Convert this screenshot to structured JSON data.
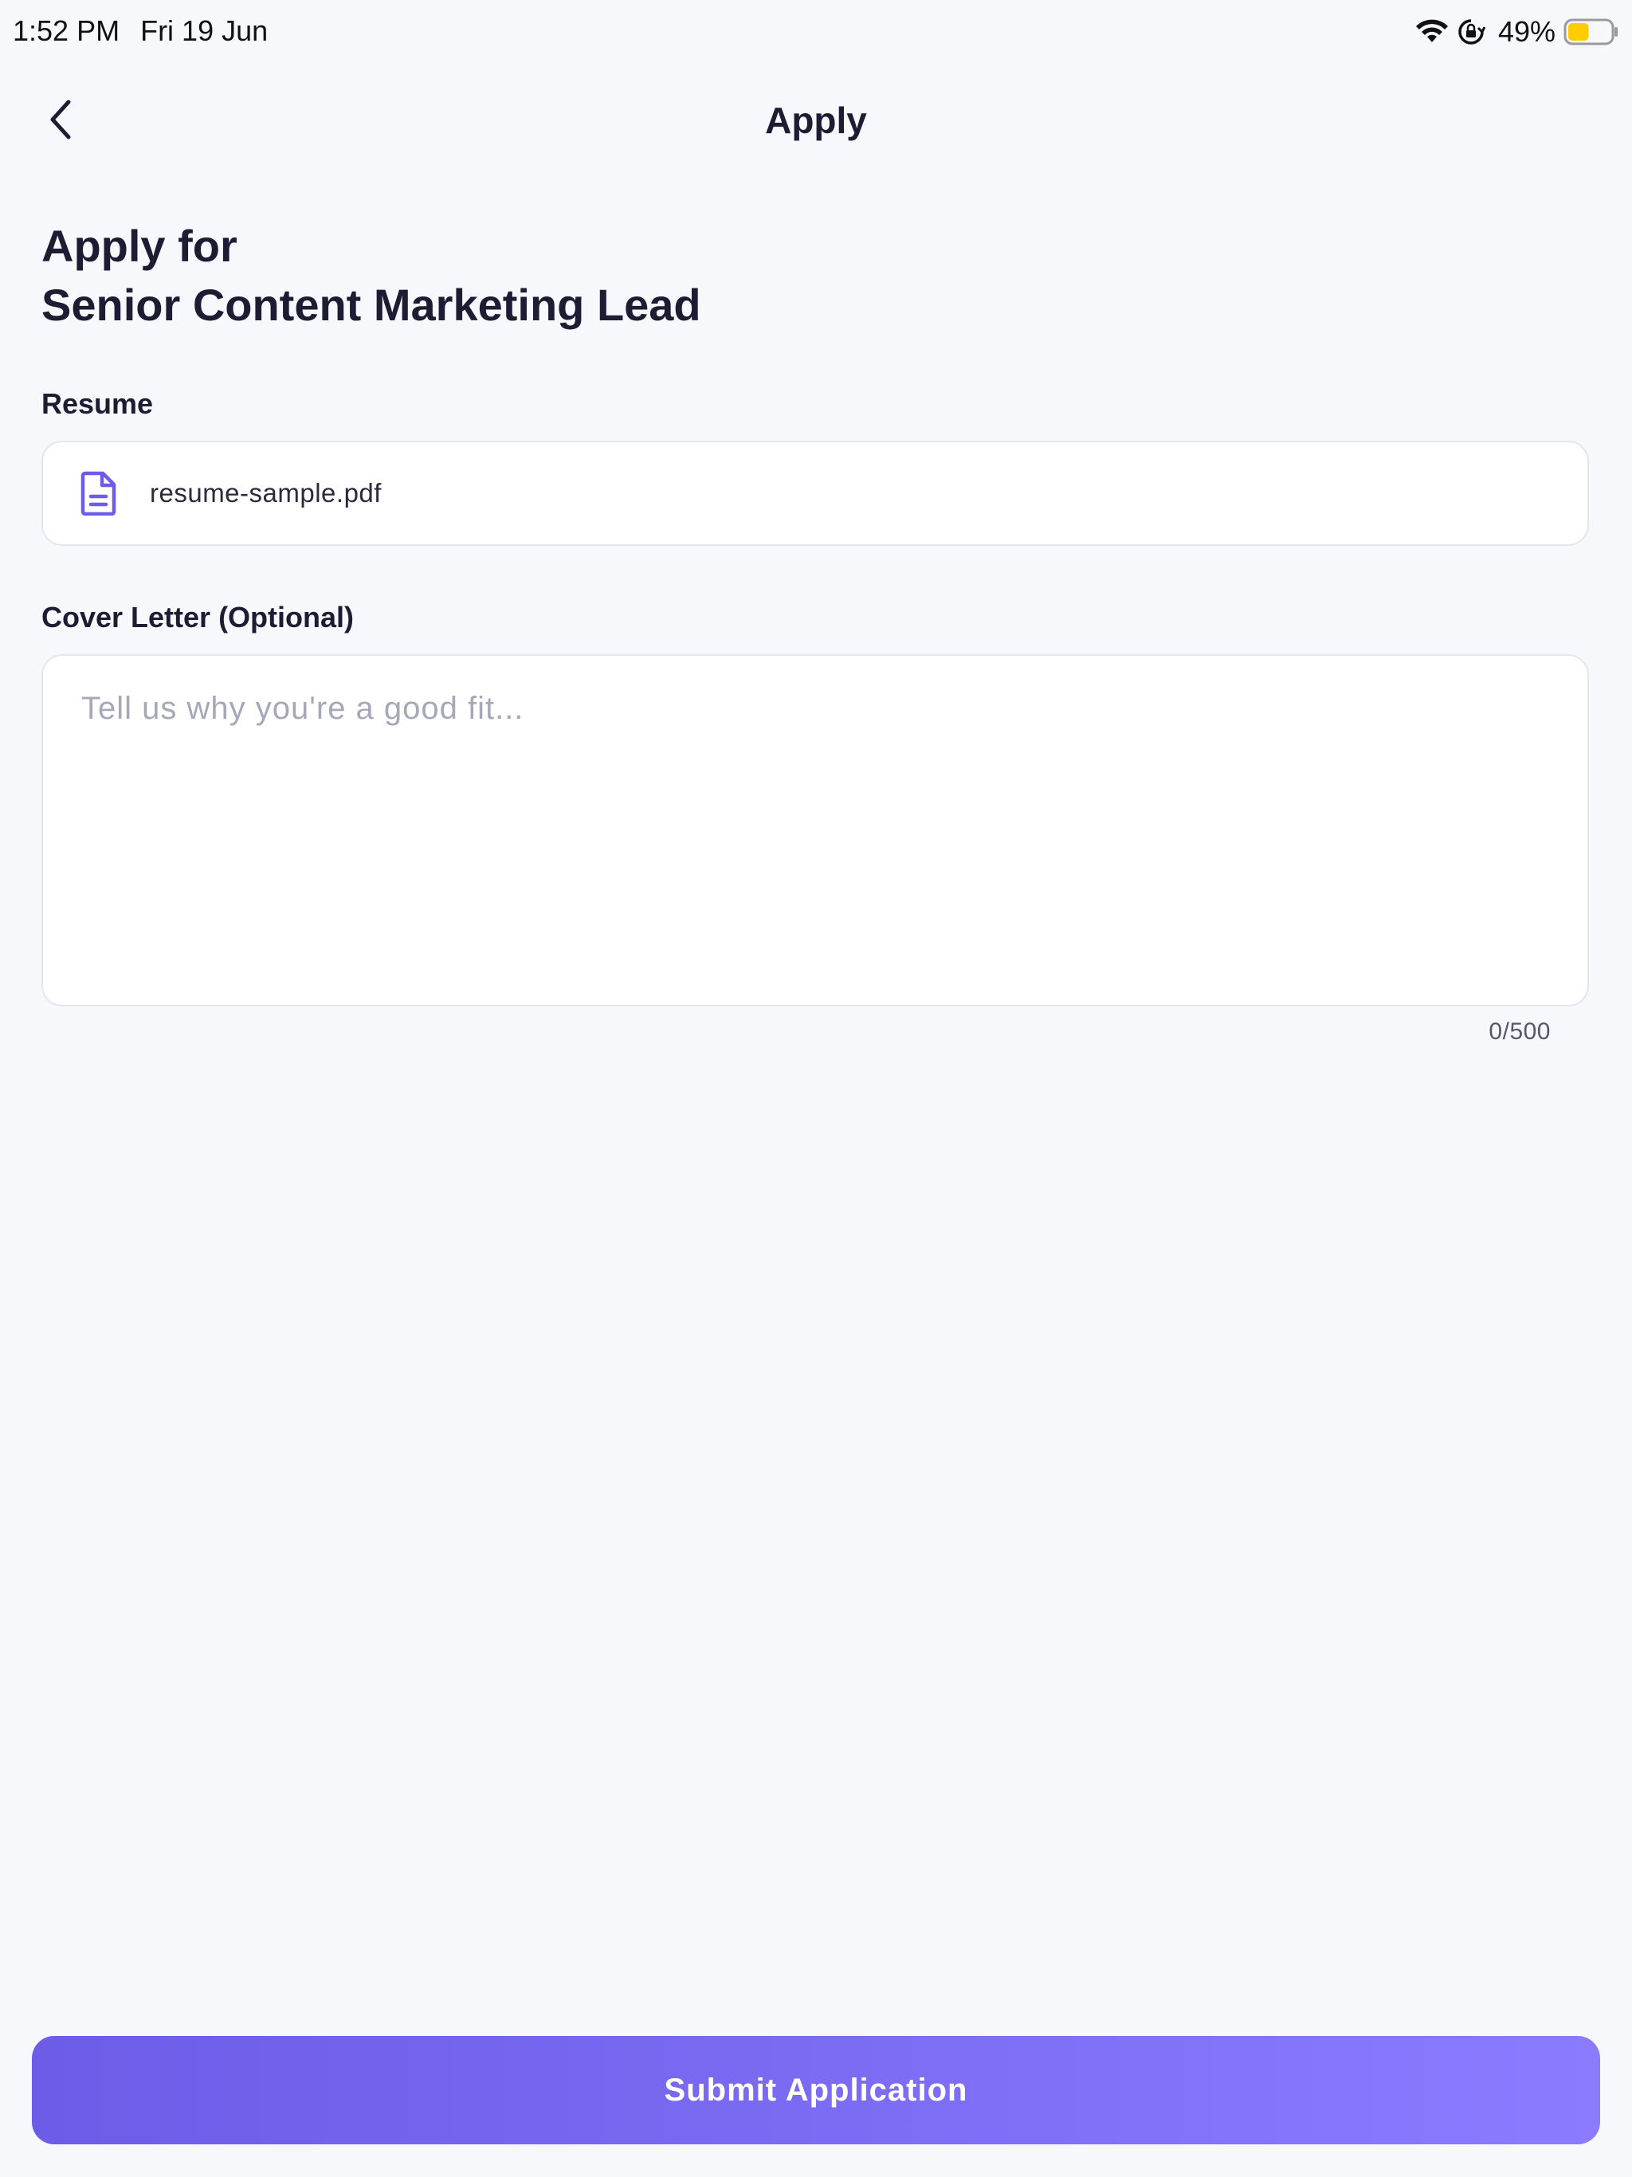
{
  "status_bar": {
    "time": "1:52 PM",
    "date": "Fri 19 Jun",
    "battery_percent": "49%",
    "battery_level": 0.49,
    "battery_color": "#FFCC00",
    "icons": [
      "wifi-icon",
      "orientation-lock-icon",
      "battery-icon"
    ]
  },
  "nav": {
    "back_icon": "chevron-left-icon",
    "title": "Apply"
  },
  "heading": {
    "line1": "Apply for",
    "line2": "Senior Content Marketing Lead"
  },
  "resume": {
    "label": "Resume",
    "icon": "document-icon",
    "filename": "resume-sample.pdf"
  },
  "cover_letter": {
    "label": "Cover Letter (Optional)",
    "value": "",
    "placeholder": "Tell us why you're a good fit...",
    "counter": "0/500"
  },
  "submit": {
    "label": "Submit Application"
  },
  "colors": {
    "accent_start": "#6C5CE7",
    "accent_end": "#8B7BFF",
    "icon_accent": "#6C5CE7",
    "background": "#F7F8FC"
  }
}
